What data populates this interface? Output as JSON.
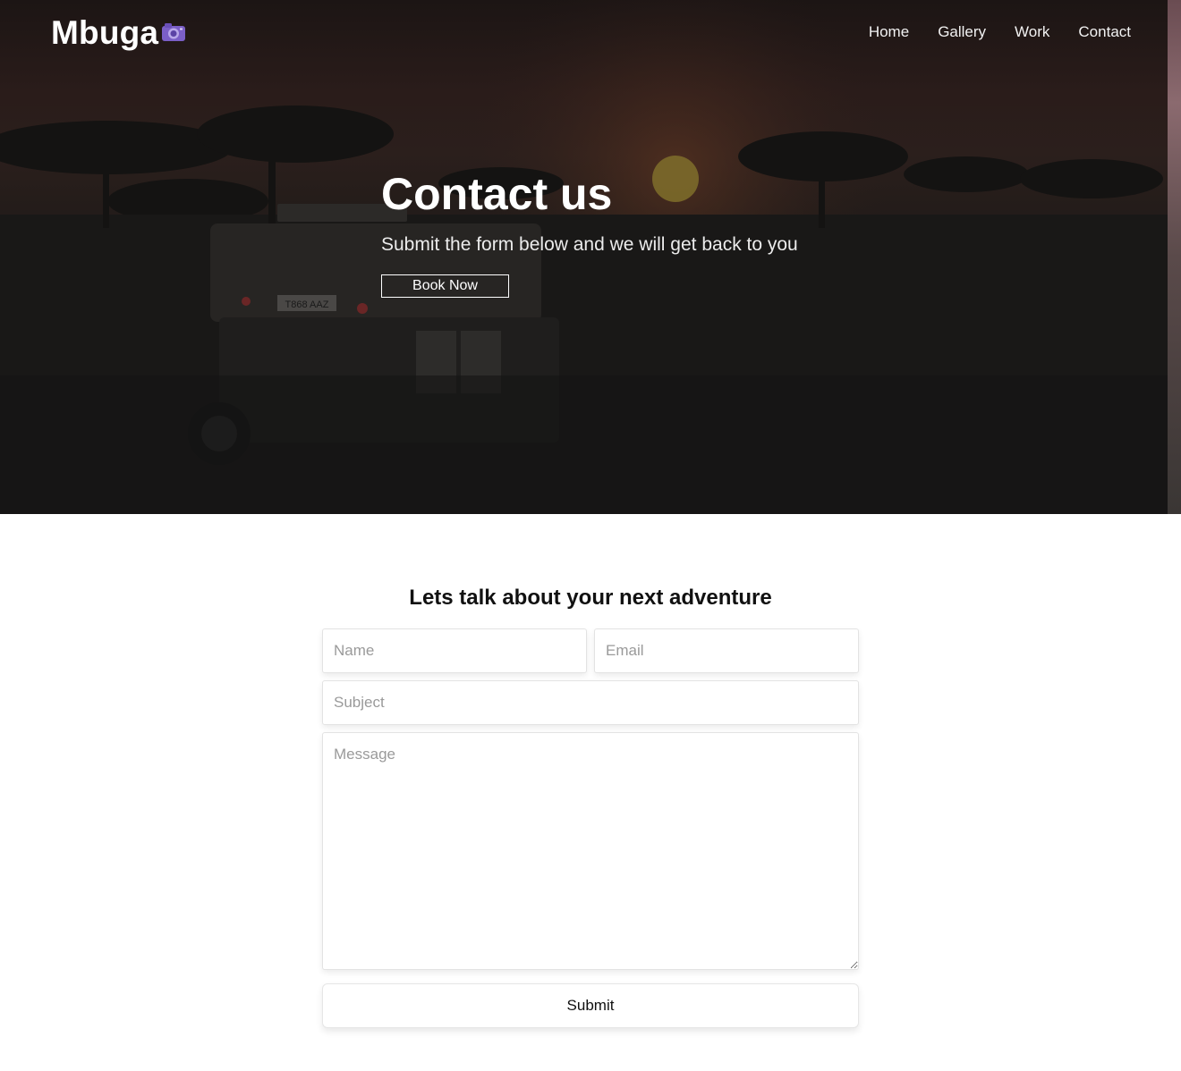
{
  "brand": {
    "name": "Mbuga",
    "icon": "camera-icon"
  },
  "nav": {
    "items": [
      "Home",
      "Gallery",
      "Work",
      "Contact"
    ]
  },
  "hero": {
    "title": "Contact us",
    "subtitle": "Submit the form below and we will get back to you",
    "button_label": "Book Now",
    "vehicle_plate": "T868 AAZ"
  },
  "form": {
    "heading": "Lets talk about your next adventure",
    "name_placeholder": "Name",
    "email_placeholder": "Email",
    "subject_placeholder": "Subject",
    "message_placeholder": "Message",
    "submit_label": "Submit"
  },
  "colors": {
    "accent_icon": "#7b5fc7",
    "hero_overlay": "#1b1817"
  }
}
